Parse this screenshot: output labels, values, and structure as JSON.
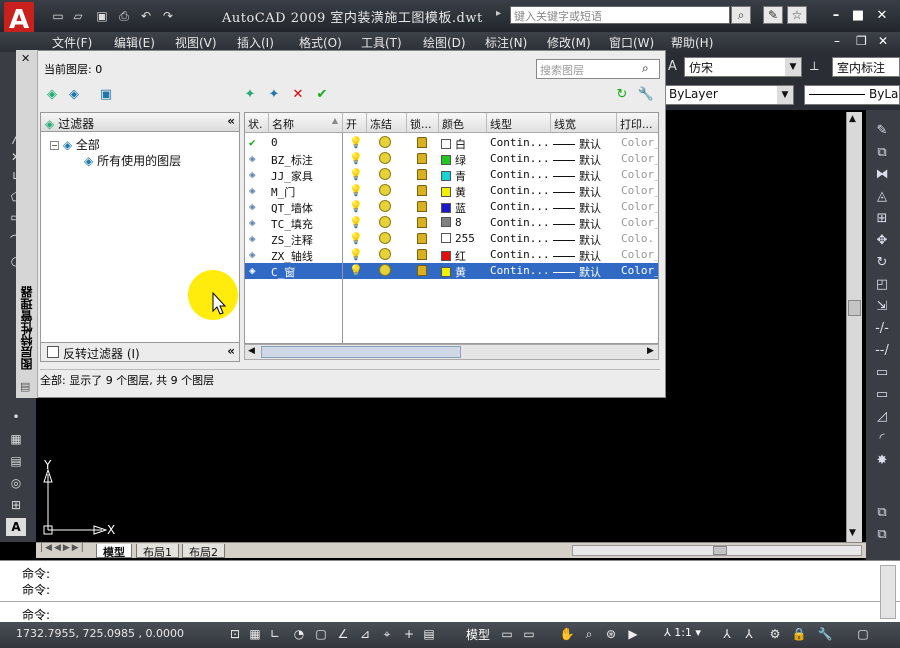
{
  "app": {
    "title": "AutoCAD 2009  室内装潢施工图模板.dwt",
    "logo": "A",
    "search_placeholder": "键入关键字或短语"
  },
  "window_controls": {
    "minimize": "–",
    "restore": "■",
    "close": "✕"
  },
  "doc_controls": {
    "minimize": "–",
    "restore": "❐",
    "close": "✕"
  },
  "menus": [
    "文件(F)",
    "编辑(E)",
    "视图(V)",
    "插入(I)",
    "格式(O)",
    "工具(T)",
    "绘图(D)",
    "标注(N)",
    "修改(M)",
    "窗口(W)",
    "帮助(H)"
  ],
  "toolbar": {
    "font_style": "仿宋",
    "dim_style": "室内标注",
    "linetype": "ByLayer",
    "lineweight": "ByLa"
  },
  "layer_palette": {
    "title": "图层特性管理器",
    "current_layer_label": "当前图层: 0",
    "search_placeholder": "搜索图层",
    "filters_header": "过滤器",
    "filter_tree": [
      "全部",
      "所有使用的图层"
    ],
    "invert_filter_label": "反转过滤器 (I)",
    "collapse": "«",
    "columns": [
      "状.",
      "名称",
      "开",
      "冻结",
      "锁...",
      "颜色",
      "线型",
      "线宽",
      "打印..."
    ],
    "layers": [
      {
        "status": "current",
        "name": "0",
        "color_name": "白",
        "color": "#ffffff",
        "linetype": "Contin...",
        "lineweight": "默认",
        "plot": "Color_"
      },
      {
        "status": "",
        "name": "BZ_标注",
        "color_name": "绿",
        "color": "#1ec81e",
        "linetype": "Contin...",
        "lineweight": "默认",
        "plot": "Color_"
      },
      {
        "status": "",
        "name": "JJ_家具",
        "color_name": "青",
        "color": "#19d2d2",
        "linetype": "Contin...",
        "lineweight": "默认",
        "plot": "Color_"
      },
      {
        "status": "",
        "name": "M_门",
        "color_name": "黄",
        "color": "#f0f000",
        "linetype": "Contin...",
        "lineweight": "默认",
        "plot": "Color_"
      },
      {
        "status": "",
        "name": "QT_墙体",
        "color_name": "蓝",
        "color": "#1a1acc",
        "linetype": "Contin...",
        "lineweight": "默认",
        "plot": "Color_"
      },
      {
        "status": "",
        "name": "TC_填充",
        "color_name": "8",
        "color": "#808080",
        "linetype": "Contin...",
        "lineweight": "默认",
        "plot": "Color_"
      },
      {
        "status": "",
        "name": "ZS_注释",
        "color_name": "255",
        "color": "#ffffff",
        "linetype": "Contin...",
        "lineweight": "默认",
        "plot": "Colo."
      },
      {
        "status": "",
        "name": "ZX_轴线",
        "color_name": "红",
        "color": "#e01010",
        "linetype": "Contin...",
        "lineweight": "默认",
        "plot": "Color_"
      },
      {
        "status": "",
        "name": "C_窗",
        "color_name": "黄",
        "color": "#f0f000",
        "linetype": "Contin...",
        "lineweight": "默认",
        "plot": "Color_"
      }
    ],
    "summary": "全部: 显示了 9 个图层, 共 9 个图层"
  },
  "ucs": {
    "x": "X",
    "y": "Y"
  },
  "tabs": [
    "模型",
    "布局1",
    "布局2"
  ],
  "command": {
    "lines": [
      "命令:",
      "命令:",
      "命令:"
    ]
  },
  "status": {
    "coords": "1732.7955,  725.0985 ,  0.0000",
    "model_label": "模型",
    "scale": "1:1"
  }
}
